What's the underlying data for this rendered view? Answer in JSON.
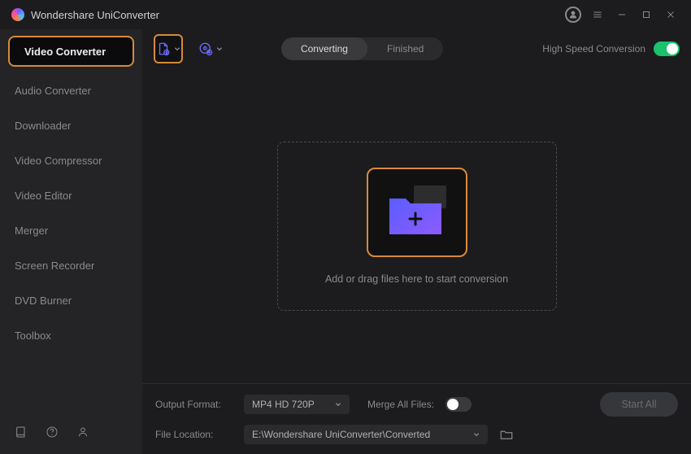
{
  "titlebar": {
    "brand": "Wondershare UniConverter"
  },
  "sidebar": {
    "items": [
      {
        "label": "Video Converter",
        "active": true
      },
      {
        "label": "Audio Converter"
      },
      {
        "label": "Downloader"
      },
      {
        "label": "Video Compressor"
      },
      {
        "label": "Video Editor"
      },
      {
        "label": "Merger"
      },
      {
        "label": "Screen Recorder"
      },
      {
        "label": "DVD Burner"
      },
      {
        "label": "Toolbox"
      }
    ]
  },
  "toolbar": {
    "tabs": {
      "converting": "Converting",
      "finished": "Finished"
    },
    "highspeed_label": "High Speed Conversion"
  },
  "dropzone": {
    "text": "Add or drag files here to start conversion"
  },
  "bottombar": {
    "output_label": "Output Format:",
    "output_value": "MP4 HD 720P",
    "merge_label": "Merge All Files:",
    "filelocation_label": "File Location:",
    "filelocation_value": "E:\\Wondershare UniConverter\\Converted",
    "startall_label": "Start All"
  }
}
